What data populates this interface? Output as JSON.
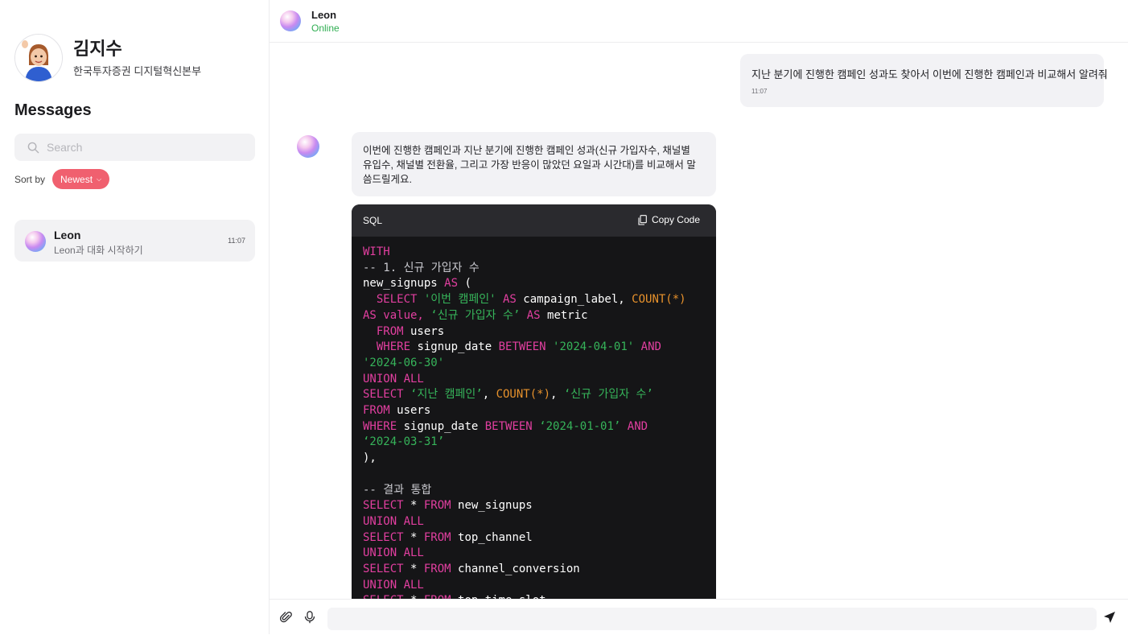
{
  "profile": {
    "name": "김지수",
    "org": "한국투자증권 디지털혁신본부"
  },
  "sidebar": {
    "title": "Messages",
    "search_placeholder": "Search",
    "sort_label": "Sort by",
    "sort_value": "Newest",
    "conversations": [
      {
        "name": "Leon",
        "preview": "Leon과 대화 시작하기",
        "time": "11:07"
      }
    ]
  },
  "chat": {
    "contact_name": "Leon",
    "contact_status": "Online",
    "messages": [
      {
        "from": "user",
        "text": "지난 분기에 진행한 캠페인 성과도 찾아서 이번에 진행한 캠페인과 비교해서 알려줘",
        "time": "11:07"
      },
      {
        "from": "bot",
        "text": "이번에 진행한 캠페인과 지난 분기에 진행한 캠페인 성과(신규 가입자수, 채널별 유입수, 채널별 전환율, 그리고 가장 반응이 많았던 요일과 시간대)를 비교해서 말씀드릴게요."
      }
    ],
    "code_block": {
      "language": "SQL",
      "copy_label": "Copy Code",
      "lines": [
        [
          [
            "kw",
            "WITH"
          ]
        ],
        [
          [
            "cm",
            "-- 1. 신규 가입자 수"
          ]
        ],
        [
          [
            "plain",
            "new_signups "
          ],
          [
            "kw",
            "AS"
          ],
          [
            "plain",
            " ("
          ]
        ],
        [
          [
            "plain",
            "  "
          ],
          [
            "kw",
            "SELECT"
          ],
          [
            "plain",
            " "
          ],
          [
            "str",
            "'이번 캠페인'"
          ],
          [
            "plain",
            " "
          ],
          [
            "kw",
            "AS"
          ],
          [
            "plain",
            " campaign_label, "
          ],
          [
            "fn",
            "COUNT(*)"
          ]
        ],
        [
          [
            "kw",
            "AS value,"
          ],
          [
            "plain",
            " "
          ],
          [
            "str",
            "‘신규 가입자 수’"
          ],
          [
            "plain",
            " "
          ],
          [
            "kw",
            "AS"
          ],
          [
            "plain",
            " metric"
          ]
        ],
        [
          [
            "plain",
            "  "
          ],
          [
            "kw",
            "FROM"
          ],
          [
            "plain",
            " users"
          ]
        ],
        [
          [
            "plain",
            "  "
          ],
          [
            "kw",
            "WHERE"
          ],
          [
            "plain",
            " signup_date "
          ],
          [
            "kw",
            "BETWEEN"
          ],
          [
            "plain",
            " "
          ],
          [
            "str",
            "'2024-04-01'"
          ],
          [
            "plain",
            " "
          ],
          [
            "kw",
            "AND"
          ]
        ],
        [
          [
            "str",
            "'2024-06-30'"
          ]
        ],
        [
          [
            "kw",
            "UNION ALL"
          ]
        ],
        [
          [
            "kw",
            "SELECT"
          ],
          [
            "plain",
            " "
          ],
          [
            "str",
            "‘지난 캠페인’"
          ],
          [
            "plain",
            ", "
          ],
          [
            "fn",
            "COUNT(*)"
          ],
          [
            "plain",
            ", "
          ],
          [
            "str",
            "‘신규 가입자 수’"
          ]
        ],
        [
          [
            "kw",
            "FROM"
          ],
          [
            "plain",
            " users"
          ]
        ],
        [
          [
            "kw",
            "WHERE"
          ],
          [
            "plain",
            " signup_date "
          ],
          [
            "kw",
            "BETWEEN"
          ],
          [
            "plain",
            " "
          ],
          [
            "str",
            "‘2024-01-01’"
          ],
          [
            "plain",
            " "
          ],
          [
            "kw",
            "AND"
          ]
        ],
        [
          [
            "str",
            "‘2024-03-31’"
          ]
        ],
        [
          [
            "plain",
            "),"
          ]
        ],
        [
          [
            "plain",
            ""
          ]
        ],
        [
          [
            "cm",
            "-- 결과 통합"
          ]
        ],
        [
          [
            "kw",
            "SELECT"
          ],
          [
            "plain",
            " * "
          ],
          [
            "kw",
            "FROM"
          ],
          [
            "plain",
            " new_signups"
          ]
        ],
        [
          [
            "kw",
            "UNION ALL"
          ]
        ],
        [
          [
            "kw",
            "SELECT"
          ],
          [
            "plain",
            " * "
          ],
          [
            "kw",
            "FROM"
          ],
          [
            "plain",
            " top_channel"
          ]
        ],
        [
          [
            "kw",
            "UNION ALL"
          ]
        ],
        [
          [
            "kw",
            "SELECT"
          ],
          [
            "plain",
            " * "
          ],
          [
            "kw",
            "FROM"
          ],
          [
            "plain",
            " channel_conversion"
          ]
        ],
        [
          [
            "kw",
            "UNION ALL"
          ]
        ],
        [
          [
            "kw",
            "SELECT"
          ],
          [
            "plain",
            " * "
          ],
          [
            "kw",
            "FROM"
          ],
          [
            "plain",
            " top_time_slot"
          ]
        ]
      ]
    }
  },
  "composer": {
    "placeholder": ""
  },
  "colors": {
    "accent": "#f0606f",
    "online": "#2fae52",
    "keyword": "#e23fa0",
    "string": "#36b45a",
    "function": "#e8922c"
  }
}
